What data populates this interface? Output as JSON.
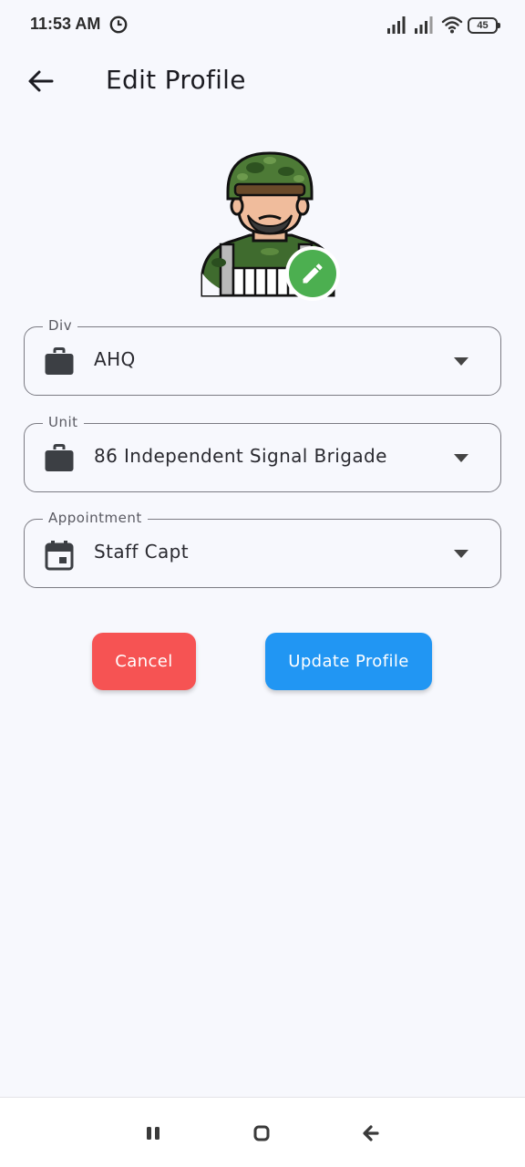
{
  "status_bar": {
    "time": "11:53 AM",
    "battery_level": "45",
    "icons": [
      "clock-icon",
      "signal-icon",
      "signal-icon",
      "wifi-icon",
      "battery-icon"
    ]
  },
  "app_bar": {
    "title": "Edit Profile",
    "back_icon": "arrow-left-icon"
  },
  "profile": {
    "avatar_icon": "soldier-avatar",
    "edit_icon": "pencil-icon"
  },
  "fields": {
    "div": {
      "label": "Div",
      "value": "AHQ",
      "icon": "briefcase-icon"
    },
    "unit": {
      "label": "Unit",
      "value": "86 Independent Signal Brigade",
      "icon": "briefcase-icon"
    },
    "appointment": {
      "label": "Appointment",
      "value": "Staff Capt",
      "icon": "calendar-icon"
    }
  },
  "actions": {
    "cancel_label": "Cancel",
    "update_label": "Update Profile"
  },
  "colors": {
    "cancel": "#f65353",
    "update": "#2196f3",
    "edit_badge": "#4caf50",
    "background": "#f7f8fd"
  },
  "nav_bar": {
    "icons": [
      "recents-icon",
      "home-icon",
      "back-icon"
    ]
  }
}
